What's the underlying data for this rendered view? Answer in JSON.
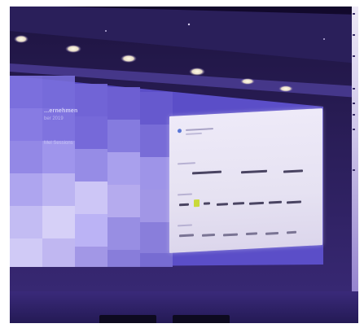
{
  "photo": {
    "colors": {
      "ceiling": "#2a1e55",
      "projection_purple": "#6a5ad6",
      "card": "#ece8f7",
      "accent_yellow": "#c9d93a",
      "accent_blue": "#5a77d6"
    }
  },
  "slide": {
    "title": "...ernehmen",
    "subtitle": "ber 2019",
    "tag": "Mel Sessions"
  }
}
